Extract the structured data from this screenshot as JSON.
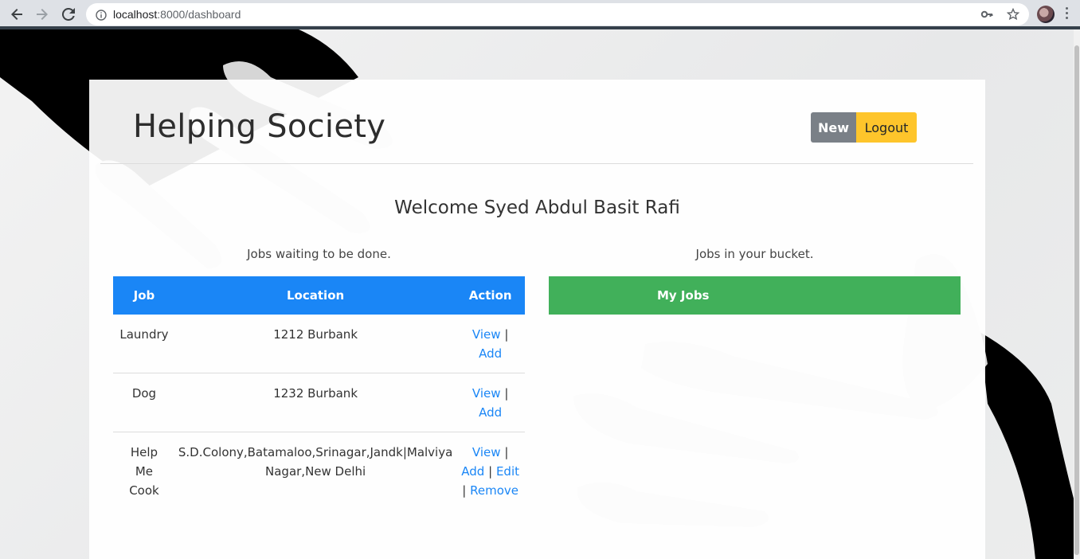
{
  "browser": {
    "url_host": "localhost",
    "url_rest": ":8000/dashboard"
  },
  "header": {
    "brand": "Helping Society",
    "new_label": "New",
    "logout_label": "Logout"
  },
  "welcome": "Welcome Syed Abdul Basit Rafi",
  "left_caption": "Jobs waiting to be done.",
  "right_caption": "Jobs in your bucket.",
  "jobs_table": {
    "headers": [
      "Job",
      "Location",
      "Action"
    ],
    "rows": [
      {
        "job": "Laundry",
        "location": "1212 Burbank",
        "actions": [
          "View",
          "Add"
        ]
      },
      {
        "job": "Dog",
        "location": "1232 Burbank",
        "actions": [
          "View",
          "Add"
        ]
      },
      {
        "job": "Help Me Cook",
        "location": "S.D.Colony,Batamaloo,Srinagar,Jandk|Malviya Nagar,New Delhi",
        "actions": [
          "View",
          "Add",
          "Edit",
          "Remove"
        ]
      }
    ]
  },
  "my_jobs_header": "My Jobs",
  "colors": {
    "primary": "#1a86f6",
    "success": "#41b05a",
    "secondary": "#7a8087",
    "warning": "#fec52b"
  }
}
